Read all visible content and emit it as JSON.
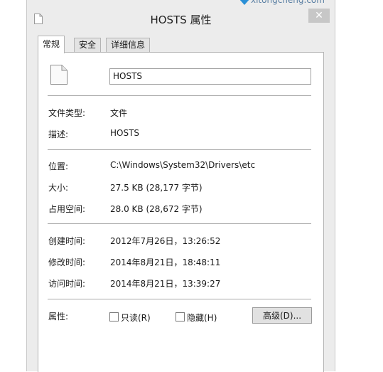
{
  "watermark": "xitongcheng.com",
  "window": {
    "title": "HOSTS 属性",
    "close_glyph": "✕"
  },
  "tabs": [
    {
      "label": "常规",
      "active": true
    },
    {
      "label": "安全",
      "active": false
    },
    {
      "label": "详细信息",
      "active": false
    }
  ],
  "general": {
    "file_name": "HOSTS",
    "file_type_label": "文件类型:",
    "file_type_value": "文件",
    "description_label": "描述:",
    "description_value": "HOSTS",
    "location_label": "位置:",
    "location_value": "C:\\Windows\\System32\\Drivers\\etc",
    "size_label": "大小:",
    "size_value": "27.5 KB (28,177 字节)",
    "size_on_disk_label": "占用空间:",
    "size_on_disk_value": "28.0 KB (28,672 字节)",
    "created_label": "创建时间:",
    "created_value": "2012年7月26日，13:26:52",
    "modified_label": "修改时间:",
    "modified_value": "2014年8月21日，18:48:11",
    "accessed_label": "访问时间:",
    "accessed_value": "2014年8月21日，13:39:27",
    "attributes_label": "属性:",
    "readonly_label": "只读(R)",
    "readonly_checked": false,
    "hidden_label": "隐藏(H)",
    "hidden_checked": false,
    "advanced_button": "高级(D)..."
  },
  "colors": {
    "window_bg": "#ececec",
    "panel_bg": "#ffffff",
    "watermark_accent": "#2a8fd6"
  }
}
